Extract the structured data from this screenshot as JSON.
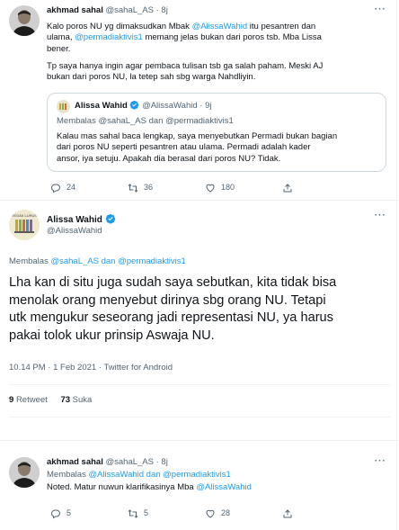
{
  "tweet1": {
    "author_name": "akhmad sahal",
    "author_handle": "@sahaL_AS",
    "time": "· 8j",
    "text_lines": [
      [
        "Kalo poros NU yg dimaksudkan Mbak ",
        "@AlissaWahid",
        " itu pesantren dan"
      ],
      [
        "ulama, ",
        "@permadiaktivis1",
        " memang jelas bukan dari poros tsb. Mba Lissa"
      ],
      [
        "bener.",
        "",
        ""
      ],
      [
        "Tp saya hanya ingin agar pembaca tulisan tsb ga salah paham. Meski AJ",
        "",
        ""
      ],
      [
        "bukan dari poros NU, la tetep sah sbg warga Nahdliyin.",
        "",
        ""
      ]
    ],
    "quote": {
      "author_name": "Alissa Wahid",
      "author_handle": "@AlissaWahid",
      "time": "· 9j",
      "reply_prefix": "Membalas ",
      "reply_to": "@sahaL_AS dan @permadiaktivis1",
      "text_lines": [
        "Kalau mas sahal baca lengkap, saya menyebutkan Permadi bukan bagian",
        "dari poros NU seperti pesantren atau ulama.  Permadi adalah kader",
        "ansor, iya setuju. Apakah dia berasal dari poros NU? Tidak."
      ]
    },
    "actions": {
      "replies": "24",
      "retweets": "36",
      "likes": "180"
    }
  },
  "main_tweet": {
    "author_name": "Alissa Wahid",
    "author_handle": "@AlissaWahid",
    "avatar_caption": "TEGAK LURUS",
    "reply_prefix": "Membalas ",
    "reply_to": "@sahaL_AS dan @permadiaktivis1",
    "text_lines": [
      "Lha kan di situ juga sudah saya sebutkan, kita tidak bisa",
      "menolak orang menyebut dirinya sbg orang NU. Tetapi",
      "utk mengukur seseorang jadi representasi NU, ya harus",
      "pakai tolok ukur prinsip Aswaja NU."
    ],
    "timestamp": "10.14 PM · 1 Feb 2021 · Twitter for Android",
    "retweet_count": "9",
    "retweet_label": "Retweet",
    "like_count": "73",
    "like_label": "Suka"
  },
  "tweet3": {
    "author_name": "akhmad sahal",
    "author_handle": "@sahaL_AS",
    "time": "· 8j",
    "reply_prefix": "Membalas ",
    "reply_to": "@AlissaWahid dan @permadiaktivis1",
    "text_prefix": "Noted. Matur nuwun klarifikasinya Mba ",
    "text_mention": "@AlissaWahid",
    "actions": {
      "replies": "5",
      "retweets": "5",
      "likes": "28"
    }
  },
  "colors": {
    "accent": "#1d9bf0",
    "muted": "#536471",
    "border": "#eff3f4"
  }
}
